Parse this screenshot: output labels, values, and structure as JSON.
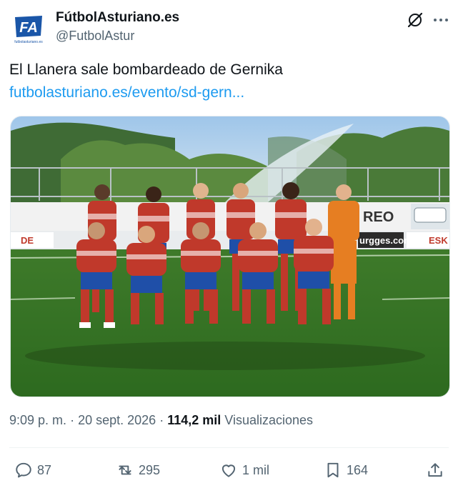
{
  "author": {
    "display_name": "FútbolAsturiano.es",
    "handle": "@FutbolAstur",
    "avatar_icon": "fa-logo-icon",
    "avatar_text": "FA",
    "avatar_subtext": "futbolasturiano.es"
  },
  "header_icons": {
    "grok": "grok-icon",
    "more": "more-options-icon"
  },
  "post": {
    "text": "El Llanera sale bombardeado de Gernika",
    "link": "futbolasturiano.es/evento/sd-gern..."
  },
  "photo": {
    "banner_text_1": "REO",
    "banner_text_2": "urgges.com",
    "banner_text_3": "ESK",
    "banner_text_4": "DE"
  },
  "meta": {
    "time": "9:09 p. m.",
    "separator": "·",
    "date": "20 sept. 2026",
    "views_count": "114,2 mil",
    "views_label": "Visualizaciones"
  },
  "actions": {
    "replies": "87",
    "reposts": "295",
    "likes": "1 mil",
    "bookmarks": "164"
  },
  "colors": {
    "link": "#1d9bf0",
    "secondary_text": "#536471",
    "primary_text": "#0f1419",
    "brand_blue": "#1a56a8"
  }
}
